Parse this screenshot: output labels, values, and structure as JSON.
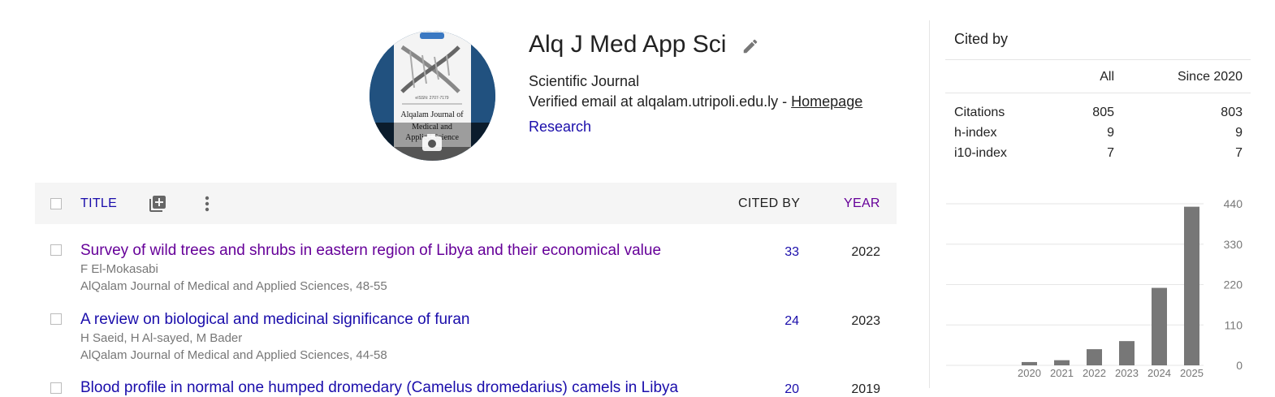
{
  "profile": {
    "name": "Alq J Med App Sci",
    "affiliation": "Scientific Journal",
    "email_prefix": "Verified email at alqalam.utripoli.edu.ly - ",
    "homepage_label": "Homepage",
    "interest": "Research",
    "avatar_text_1": "Alqalam Journal of",
    "avatar_text_2": "Medical and",
    "avatar_text_3": "Applied Science",
    "avatar_issn": "eISSN: 2707-7179"
  },
  "table": {
    "header_title": "TITLE",
    "header_cited": "CITED BY",
    "header_year": "YEAR",
    "rows": [
      {
        "title": "Survey of wild trees and shrubs in eastern region of Libya and their economical value",
        "authors": "F El-Mokasabi",
        "venue": "AlQalam Journal of Medical and Applied Sciences, 48-55",
        "cited": "33",
        "year": "2022"
      },
      {
        "title": "A review on biological and medicinal significance of furan",
        "authors": "H Saeid, H Al-sayed, M Bader",
        "venue": "AlQalam Journal of Medical and Applied Sciences, 44-58",
        "cited": "24",
        "year": "2023"
      },
      {
        "title": "Blood profile in normal one humped dromedary (Camelus dromedarius) camels in Libya",
        "cited": "20",
        "year": "2019"
      }
    ]
  },
  "cited_by": {
    "heading": "Cited by",
    "col_all": "All",
    "col_since": "Since 2020",
    "rows": [
      {
        "label": "Citations",
        "all": "805",
        "since": "803"
      },
      {
        "label": "h-index",
        "all": "9",
        "since": "9"
      },
      {
        "label": "i10-index",
        "all": "7",
        "since": "7"
      }
    ]
  },
  "chart_data": {
    "type": "bar",
    "categories": [
      "2020",
      "2021",
      "2022",
      "2023",
      "2024",
      "2025"
    ],
    "values": [
      9,
      14,
      44,
      66,
      211,
      432
    ],
    "yticks": [
      "440",
      "330",
      "220",
      "110",
      "0"
    ],
    "ylim": [
      0,
      440
    ],
    "bar_color": "#777777",
    "grid": true
  }
}
